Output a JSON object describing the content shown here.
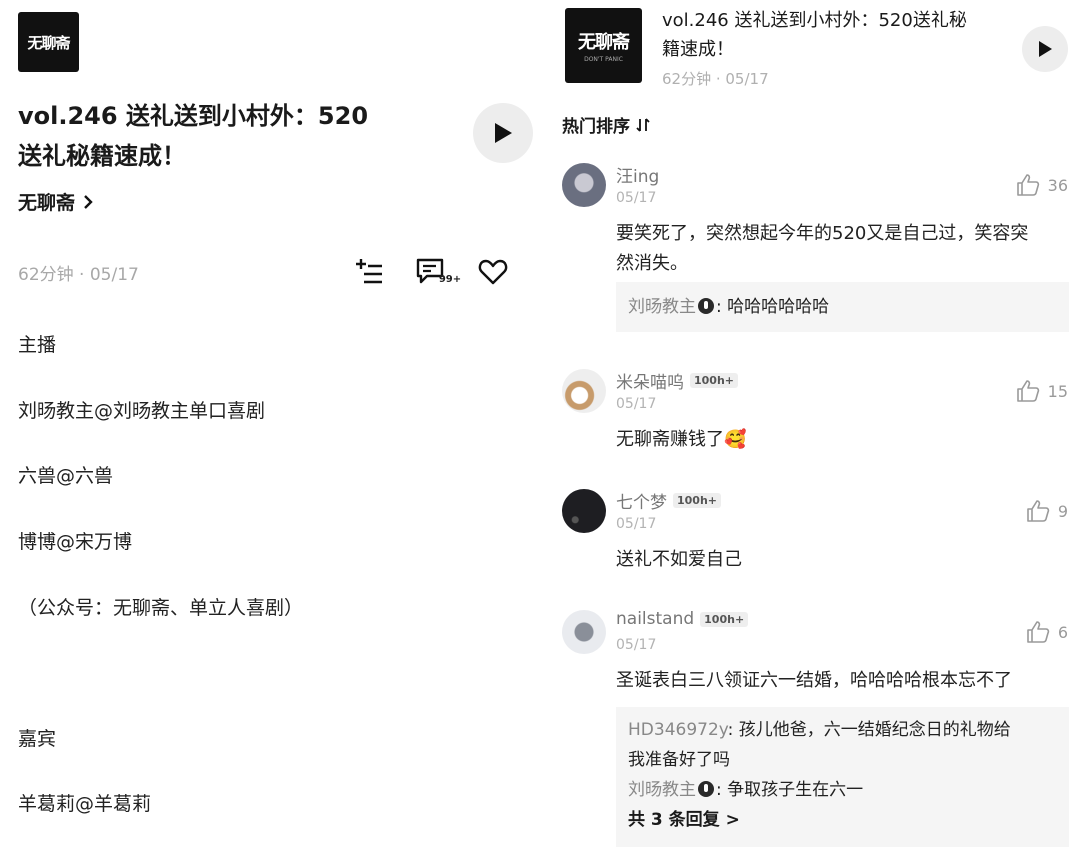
{
  "left": {
    "logo_text": "无聊斋",
    "episode_title_line1": "vol.246 送礼送到小村外：520",
    "episode_title_line2": "送礼秘籍速成！",
    "podcast_name": "无聊斋",
    "meta": "62分钟 · 05/17",
    "comment_count": "99+",
    "description": [
      "主播",
      "刘旸教主@刘旸教主单口喜剧",
      "六兽@六兽",
      "博博@宋万博",
      "（公众号：无聊斋、单立人喜剧）",
      "嘉宾",
      "羊葛莉@羊葛莉"
    ]
  },
  "right": {
    "logo_text": "无聊斋",
    "logo_subtext": "DON'T PANIC",
    "episode_title_line1": "vol.246 送礼送到小村外：520送礼秘",
    "episode_title_line2": "籍速成！",
    "meta": "62分钟 · 05/17",
    "sort_label": "热门排序",
    "comments": [
      {
        "user": "汪ing",
        "badge": "",
        "date": "05/17",
        "likes": "36",
        "text_line1": "要笑死了，突然想起今年的520又是自己过，笑容突",
        "text_line2": "然消失。",
        "reply_user": "刘旸教主",
        "reply_text": ": 哈哈哈哈哈哈"
      },
      {
        "user": "米朵喵呜",
        "badge": "100h+",
        "date": "05/17",
        "likes": "15",
        "text_line1": "无聊斋赚钱了🥰"
      },
      {
        "user": "七个梦",
        "badge": "100h+",
        "date": "05/17",
        "likes": "9",
        "text_line1": "送礼不如爱自己"
      },
      {
        "user": "nailstand",
        "badge": "100h+",
        "date": "05/17",
        "likes": "6",
        "text_line1": "圣诞表白三八领证六一结婚，哈哈哈哈根本忘不了",
        "reply1_user": "HD346972y",
        "reply1_text_line1": ": 孩儿他爸，六一结婚纪念日的礼物给",
        "reply1_text_line2": "我准备好了吗",
        "reply2_user": "刘旸教主",
        "reply2_text": ": 争取孩子生在六一",
        "more_replies": "共 3 条回复 >"
      }
    ]
  }
}
